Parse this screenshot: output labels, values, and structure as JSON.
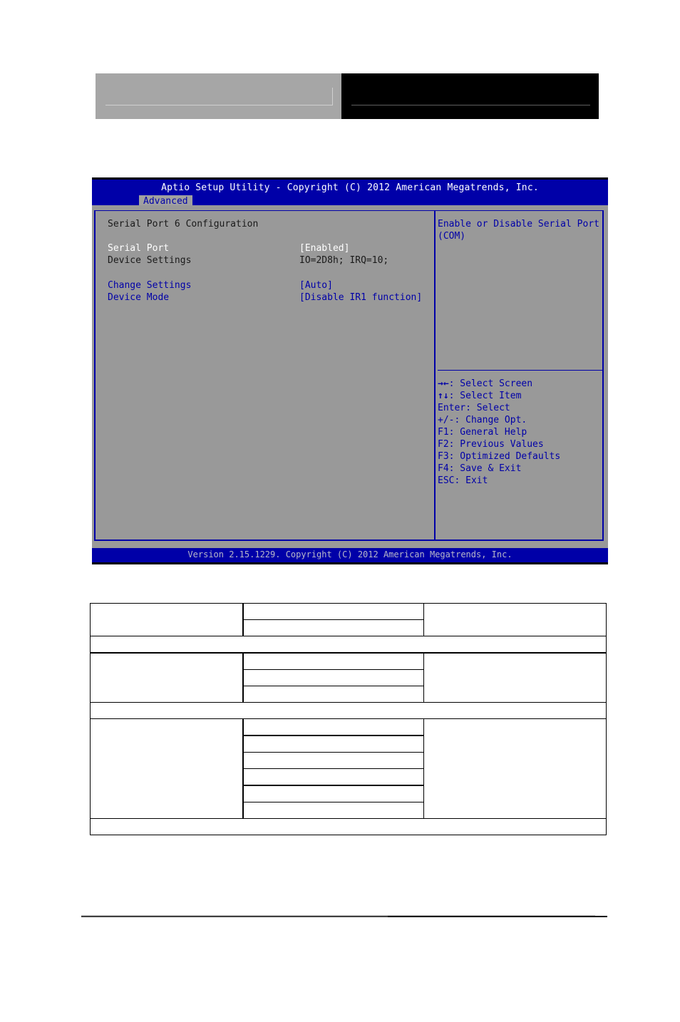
{
  "bios": {
    "title": "Aptio Setup Utility - Copyright (C) 2012 American Megatrends, Inc.",
    "active_tab": "Advanced",
    "section_title": "Serial Port 6 Configuration",
    "items": [
      {
        "label": "Serial Port",
        "value": "[Enabled]",
        "selected": true
      },
      {
        "label": "Device Settings",
        "value": "IO=2D8h; IRQ=10;",
        "readonly": true
      },
      {
        "label": "Change Settings",
        "value": "[Auto]"
      },
      {
        "label": "Device Mode",
        "value": "[Disable IR1 function]"
      }
    ],
    "help_text": [
      "Enable or Disable Serial Port",
      "(COM)"
    ],
    "key_help": [
      {
        "key": "→←",
        "desc": ": Select Screen"
      },
      {
        "key": "↑↓",
        "desc": ": Select Item"
      },
      {
        "key": "Enter",
        "desc": ": Select"
      },
      {
        "key": "+/-",
        "desc": ": Change Opt."
      },
      {
        "key": "F1",
        "desc": ": General Help"
      },
      {
        "key": "F2",
        "desc": ": Previous Values"
      },
      {
        "key": "F3",
        "desc": ": Optimized Defaults"
      },
      {
        "key": "F4",
        "desc": ": Save & Exit"
      },
      {
        "key": "ESC",
        "desc": ": Exit"
      }
    ],
    "version": "Version 2.15.1229. Copyright (C) 2012 American Megatrends, Inc.",
    "colors": {
      "blue": "#0000a8",
      "gray": "#999999",
      "highlight": "#ffffff"
    }
  }
}
